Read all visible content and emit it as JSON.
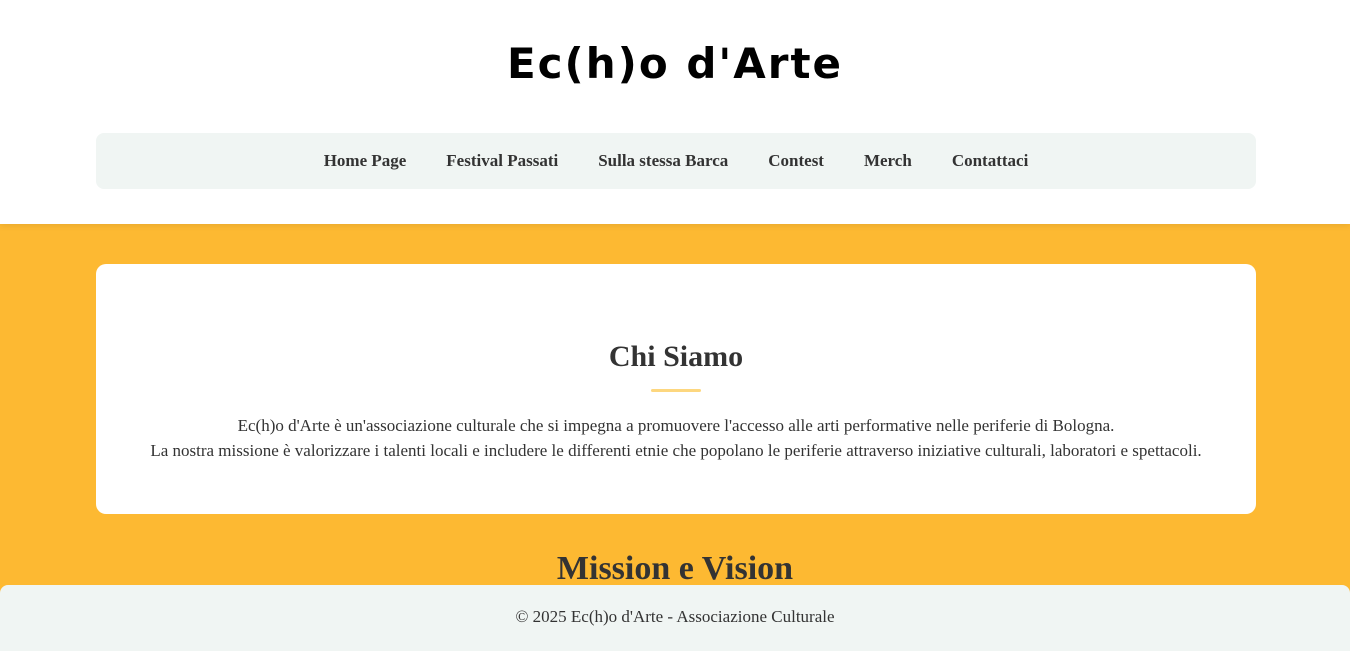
{
  "header": {
    "logo": "Ec(h)o d'Arte"
  },
  "nav": {
    "items": [
      {
        "label": "Home Page"
      },
      {
        "label": "Festival Passati"
      },
      {
        "label": "Sulla stessa Barca"
      },
      {
        "label": "Contest"
      },
      {
        "label": "Merch"
      },
      {
        "label": "Contattaci"
      }
    ]
  },
  "about": {
    "title": "Chi Siamo",
    "paragraph_1": "Ec(h)o d'Arte è un'associazione culturale che si impegna a promuovere l'accesso alle arti performative nelle periferie di Bologna.",
    "paragraph_2": "La nostra missione è valorizzare i talenti locali e includere le differenti etnie che popolano le periferie attraverso iniziative culturali, laboratori e spettacoli."
  },
  "mission": {
    "title": "Mission e Vision"
  },
  "footer": {
    "text": "© 2025 Ec(h)o d'Arte - Associazione Culturale"
  },
  "colors": {
    "page_background": "#fdb932",
    "nav_background": "#f0f5f3",
    "accent_divider": "#fdd77f",
    "text": "#333333"
  }
}
